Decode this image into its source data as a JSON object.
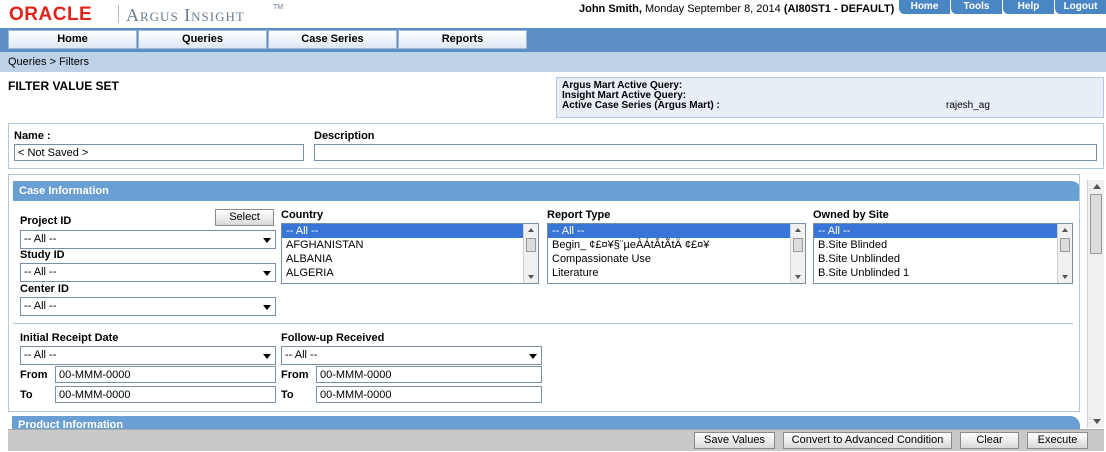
{
  "colors": {
    "brand_red": "#e2231a",
    "nav_blue": "#5b8fc6",
    "section_blue": "#6a9fd3",
    "selected_blue": "#3875d7"
  },
  "header": {
    "oracle": "ORACLE",
    "product": "Argus Insight",
    "tm": "TM",
    "user_name": "John Smith,",
    "date": "Monday September 8, 2014",
    "db": "(AI80ST1 - DEFAULT)",
    "links": [
      "Home",
      "Tools",
      "Help",
      "Logout"
    ]
  },
  "nav": {
    "tabs": [
      "Home",
      "Queries",
      "Case Series",
      "Reports"
    ]
  },
  "breadcrumb": "Queries  >  Filters",
  "page_title": "FILTER VALUE SET",
  "active": {
    "argus_mart_query": "Argus Mart Active Query:",
    "insight_mart_query": "Insight Mart Active Query:",
    "case_series": "Active Case Series (Argus Mart) :",
    "case_series_user": "rajesh_ag"
  },
  "name_section": {
    "name_label": "Name :",
    "name_value": "< Not Saved >",
    "description_label": "Description",
    "description_value": ""
  },
  "case_info": {
    "title": "Case Information",
    "select_button": "Select",
    "project_id": {
      "label": "Project ID",
      "value": "-- All --"
    },
    "study_id": {
      "label": "Study ID",
      "value": "-- All --"
    },
    "center_id": {
      "label": "Center ID",
      "value": "-- All --"
    },
    "country": {
      "label": "Country",
      "items": [
        "-- All --",
        "AFGHANISTAN",
        "ALBANIA",
        "ALGERIA"
      ]
    },
    "report_type": {
      "label": "Report Type",
      "items": [
        "-- All --",
        "Begin_ ¢£¤¥§¨µeÀÁtÂtÃtÄ ¢£¤¥",
        "Compassionate Use",
        "Literature"
      ]
    },
    "owned_by_site": {
      "label": "Owned by Site",
      "items": [
        "-- All --",
        "B.Site Blinded",
        "B.Site Unblinded",
        "B.Site Unblinded 1"
      ]
    },
    "initial_receipt": {
      "label": "Initial Receipt Date",
      "value": "-- All --",
      "from_label": "From",
      "from": "00-MMM-0000",
      "to_label": "To",
      "to": "00-MMM-0000"
    },
    "followup": {
      "label": "Follow-up Received",
      "value": "-- All --",
      "from_label": "From",
      "from": "00-MMM-0000",
      "to_label": "To",
      "to": "00-MMM-0000"
    }
  },
  "product_info": {
    "title": "Product Information"
  },
  "footer": {
    "buttons": [
      "Save Values",
      "Convert to Advanced Condition",
      "Clear",
      "Execute"
    ]
  }
}
